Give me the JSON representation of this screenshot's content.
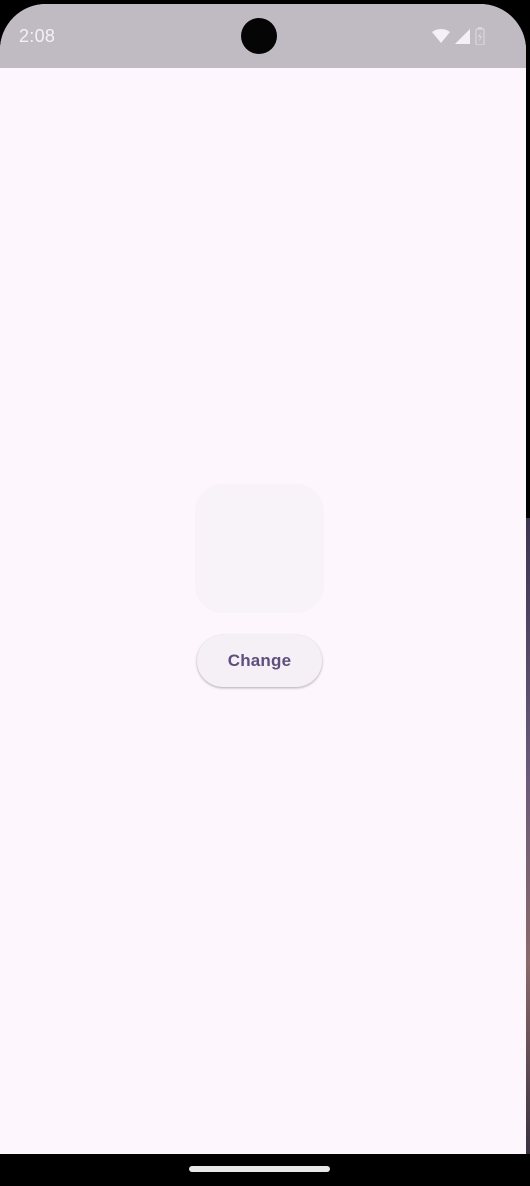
{
  "status_bar": {
    "time": "2:08",
    "icons": [
      "wifi-icon",
      "cellular-signal-icon",
      "battery-icon"
    ],
    "background_color": "#c0bac2"
  },
  "main": {
    "image_placeholder_color": "#f8f3f8",
    "change_button": {
      "label": "Change",
      "text_color": "#5e4f7d"
    },
    "background_color": "#fdf6fd"
  },
  "navigation": {
    "gesture_handle": "home-handle"
  }
}
